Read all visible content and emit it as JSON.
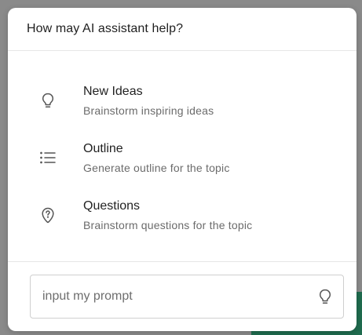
{
  "header": {
    "title": "How may AI assistant help?"
  },
  "options": [
    {
      "title": "New Ideas",
      "description": "Brainstorm inspiring ideas",
      "icon": "lightbulb-icon"
    },
    {
      "title": "Outline",
      "description": "Generate outline for the topic",
      "icon": "list-icon"
    },
    {
      "title": "Questions",
      "description": "Brainstorm questions for the topic",
      "icon": "question-pin-icon"
    }
  ],
  "prompt": {
    "placeholder": "input my prompt",
    "value": "",
    "icon": "lightbulb-icon"
  },
  "colors": {
    "overlay": "#8a8a8a",
    "dialog_bg": "#ffffff",
    "title_text": "#1f1f1f",
    "description_text": "#6b6b6b",
    "divider": "#e6e6e6",
    "icon_stroke": "#555555",
    "background_accent": "#1f6b4e"
  }
}
